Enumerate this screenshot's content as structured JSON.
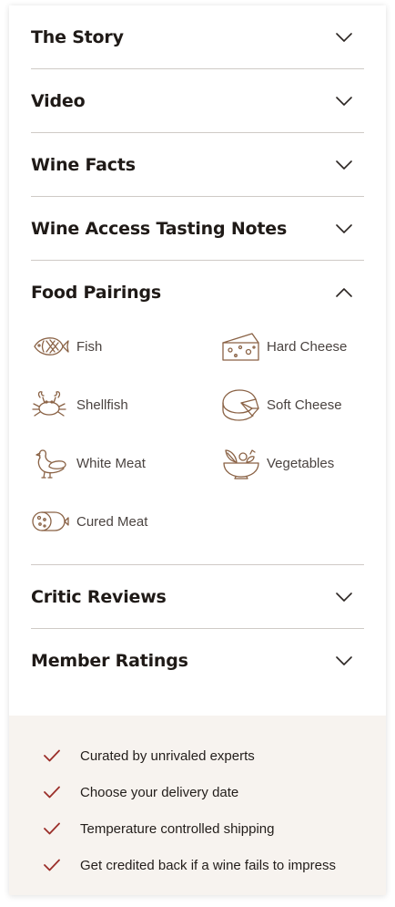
{
  "colors": {
    "accent": "#9b2f2a",
    "icon_stroke": "#8a6245",
    "divider": "#cfcac6",
    "benefits_background": "#f7f3ef"
  },
  "accordion": {
    "sections": [
      {
        "title": "The Story",
        "state": "collapsed",
        "icon": "chevron-down-icon"
      },
      {
        "title": "Video",
        "state": "collapsed",
        "icon": "chevron-down-icon"
      },
      {
        "title": "Wine Facts",
        "state": "collapsed",
        "icon": "chevron-down-icon"
      },
      {
        "title": "Wine Access Tasting Notes",
        "state": "collapsed",
        "icon": "chevron-down-icon"
      },
      {
        "title": "Food Pairings",
        "state": "expanded",
        "icon": "chevron-up-icon"
      },
      {
        "title": "Critic Reviews",
        "state": "collapsed",
        "icon": "chevron-down-icon"
      },
      {
        "title": "Member Ratings",
        "state": "collapsed",
        "icon": "chevron-down-icon"
      }
    ]
  },
  "food_pairings": {
    "items": [
      {
        "label": "Fish",
        "icon": "fish-icon"
      },
      {
        "label": "Hard Cheese",
        "icon": "hard-cheese-icon"
      },
      {
        "label": "Shellfish",
        "icon": "crab-icon"
      },
      {
        "label": "Soft Cheese",
        "icon": "soft-cheese-icon"
      },
      {
        "label": "White Meat",
        "icon": "chicken-icon"
      },
      {
        "label": "Vegetables",
        "icon": "vegetables-icon"
      },
      {
        "label": "Cured Meat",
        "icon": "salami-icon"
      }
    ]
  },
  "benefits": {
    "icon": "checkmark-icon",
    "items": [
      "Curated by unrivaled experts",
      "Choose your delivery date",
      "Temperature controlled shipping",
      "Get credited back if a wine fails to impress"
    ]
  }
}
